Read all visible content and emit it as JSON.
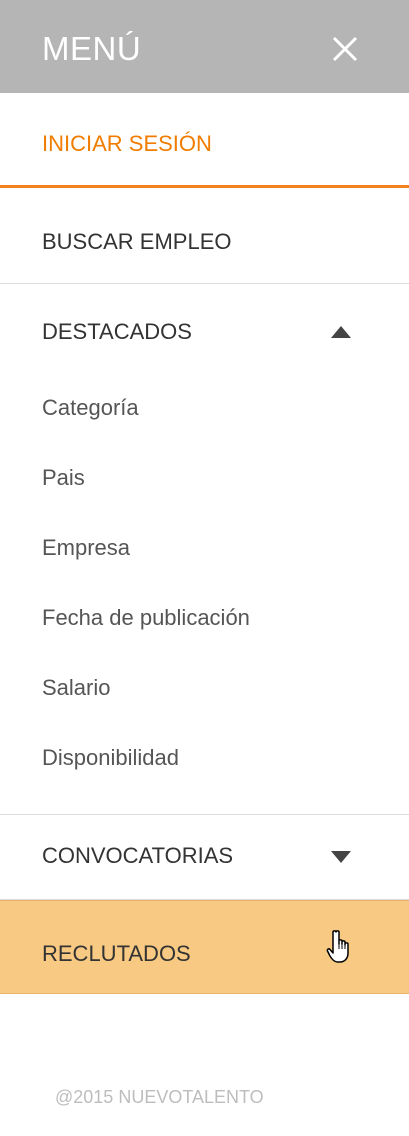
{
  "header": {
    "title": "MENÚ",
    "close_icon": "close-icon",
    "background_color": "#b5b5b5"
  },
  "menu": {
    "login_label": "INICIAR SESIÓN",
    "buscar_label": "BUSCAR EMPLEO",
    "destacados": {
      "label": "DESTACADOS",
      "expanded": true,
      "toggle_icon": "triangle-up-icon",
      "sub_items": [
        "Categoría",
        "Pais",
        "Empresa",
        "Fecha de publicación",
        "Salario",
        "Disponibilidad"
      ]
    },
    "convocatorias": {
      "label": "CONVOCATORIAS",
      "expanded": false,
      "toggle_icon": "triangle-down-icon"
    },
    "reclutados": {
      "label": "RECLUTADOS",
      "hovered": true,
      "cursor_icon": "hand-pointer-icon"
    }
  },
  "footer": {
    "copyright": "@2015 NUEVOTALENTO"
  },
  "colors": {
    "accent": "#f07d00",
    "highlight": "#f7c982"
  }
}
